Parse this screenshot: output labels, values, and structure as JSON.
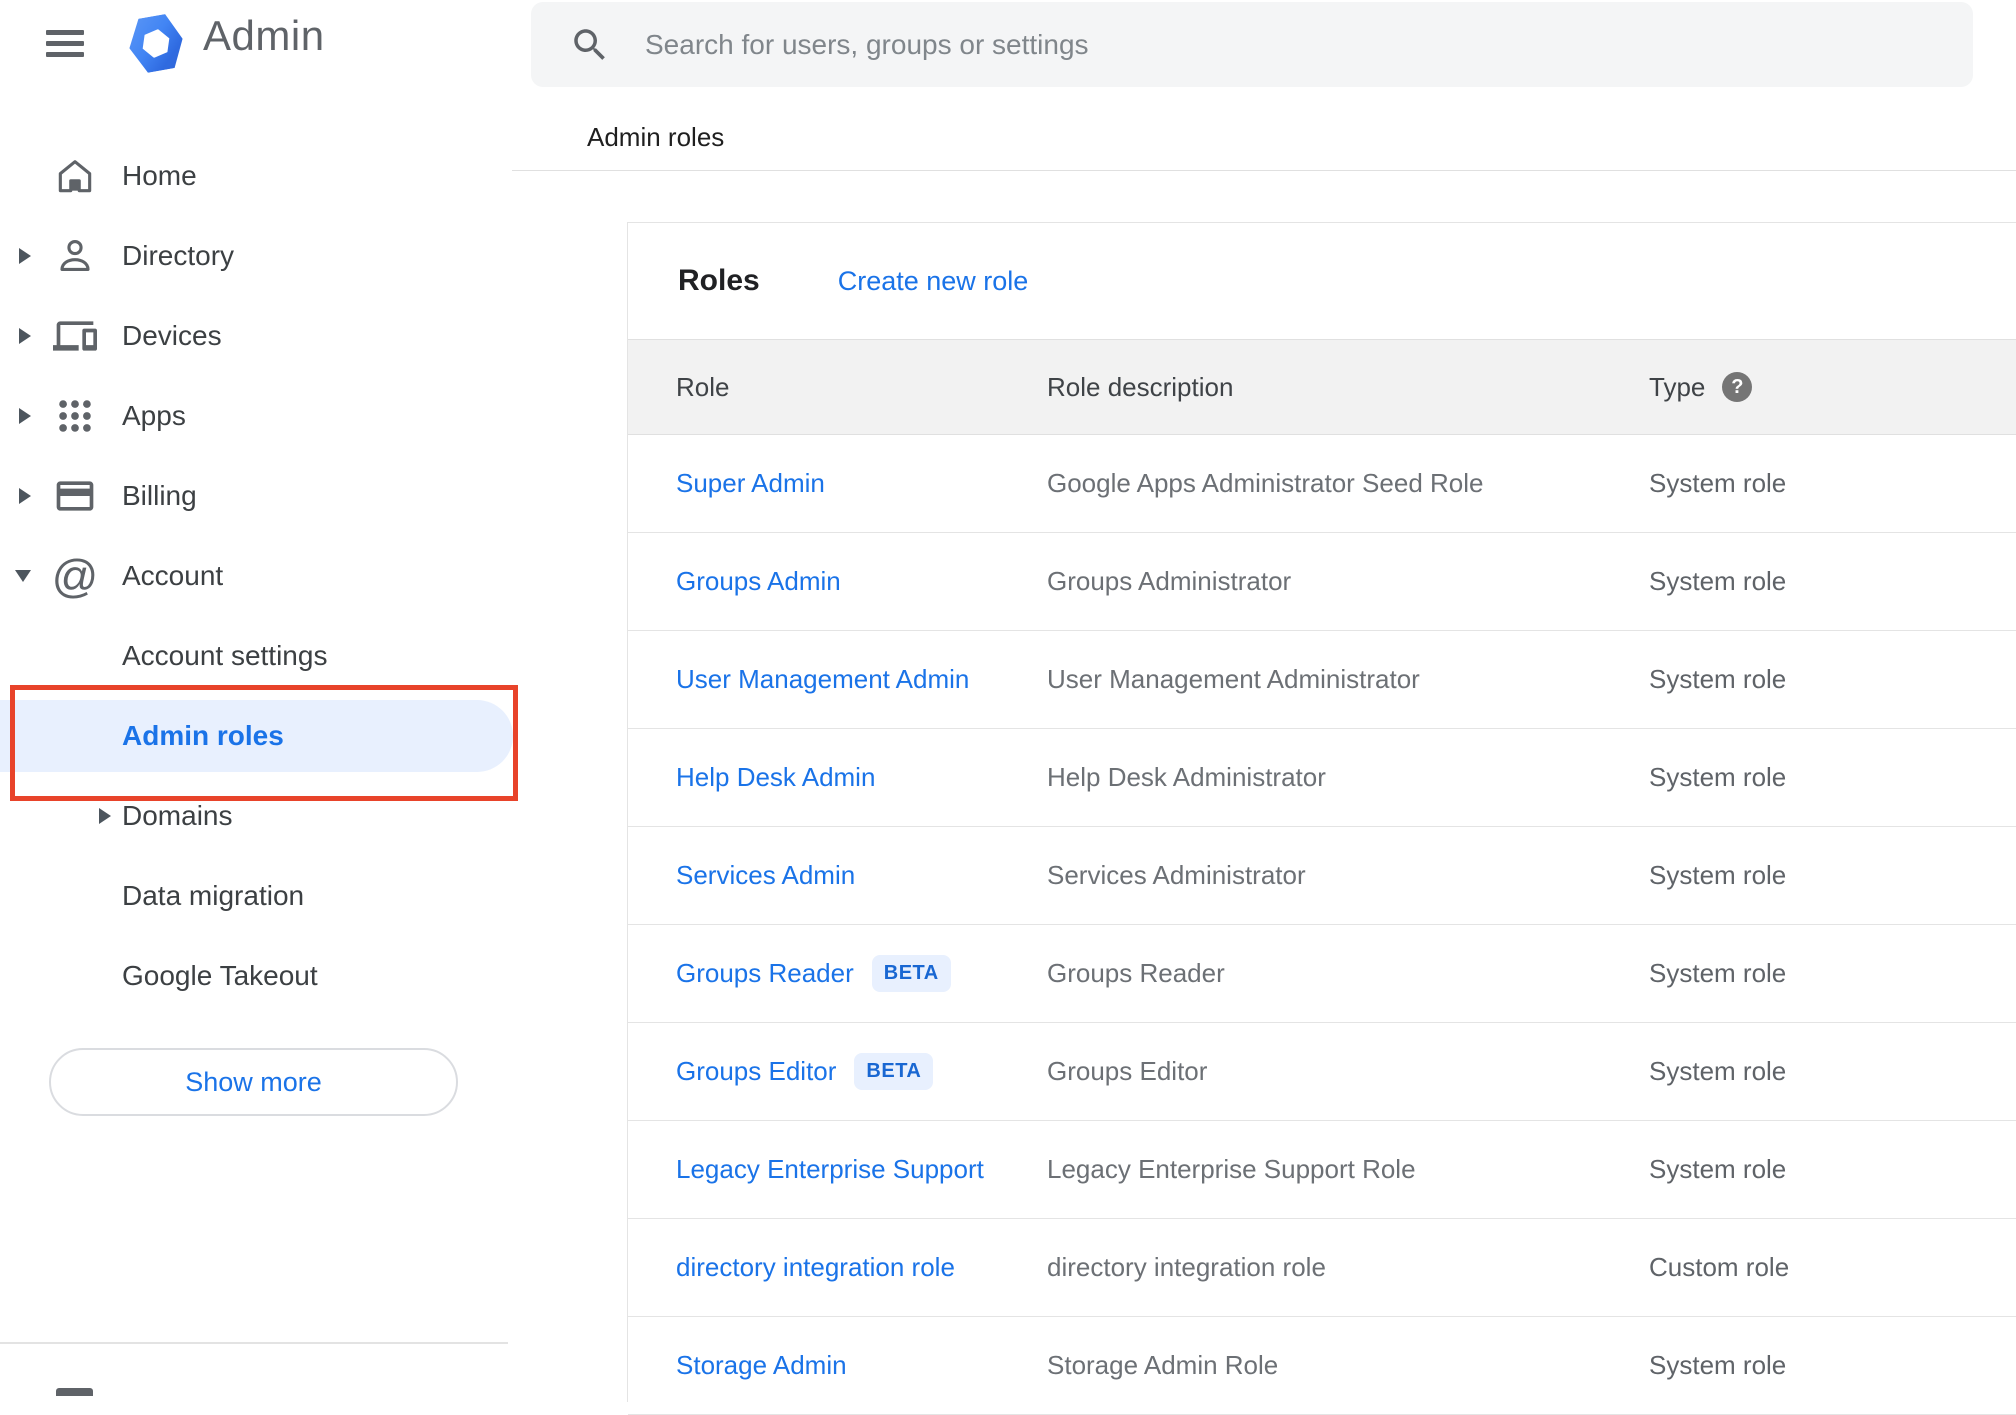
{
  "header": {
    "app_title": "Admin",
    "search_placeholder": "Search for users, groups or settings"
  },
  "breadcrumb": "Admin roles",
  "sidebar": {
    "items": [
      {
        "label": "Home"
      },
      {
        "label": "Directory"
      },
      {
        "label": "Devices"
      },
      {
        "label": "Apps"
      },
      {
        "label": "Billing"
      },
      {
        "label": "Account"
      },
      {
        "label": "Account settings"
      },
      {
        "label": "Admin roles",
        "selected": true
      },
      {
        "label": "Domains"
      },
      {
        "label": "Data migration"
      },
      {
        "label": "Google Takeout"
      }
    ],
    "show_more_label": "Show more"
  },
  "roles_panel": {
    "title": "Roles",
    "create_link": "Create new role",
    "columns": {
      "role": "Role",
      "description": "Role description",
      "type": "Type"
    },
    "rows": [
      {
        "role": "Super Admin",
        "description": "Google Apps Administrator Seed Role",
        "type": "System role"
      },
      {
        "role": "Groups Admin",
        "description": "Groups Administrator",
        "type": "System role"
      },
      {
        "role": "User Management Admin",
        "description": "User Management Administrator",
        "type": "System role"
      },
      {
        "role": "Help Desk Admin",
        "description": "Help Desk Administrator",
        "type": "System role"
      },
      {
        "role": "Services Admin",
        "description": "Services Administrator",
        "type": "System role"
      },
      {
        "role": "Groups Reader",
        "badge": "BETA",
        "description": "Groups Reader",
        "type": "System role"
      },
      {
        "role": "Groups Editor",
        "badge": "BETA",
        "description": "Groups Editor",
        "type": "System role"
      },
      {
        "role": "Legacy Enterprise Support",
        "description": "Legacy Enterprise Support Role",
        "type": "System role"
      },
      {
        "role": "directory integration role",
        "description": "directory integration role",
        "type": "Custom role"
      },
      {
        "role": "Storage Admin",
        "description": "Storage Admin Role",
        "type": "System role"
      }
    ]
  },
  "icons": {
    "help_glyph": "?",
    "account_at_glyph": "@"
  },
  "colors": {
    "link_blue": "#1a73e8",
    "selected_item_bg": "#e8f0fe",
    "annotation_red": "#e8432a",
    "beta_badge_bg": "#e8f0fe",
    "beta_badge_text": "#1967d2",
    "table_header_bg": "#f2f2f2",
    "search_bar_bg": "#f4f5f6",
    "icon_gray": "#5f6368"
  }
}
